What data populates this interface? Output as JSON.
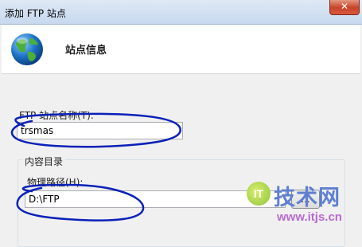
{
  "window": {
    "title": "添加 FTP 站点",
    "close_glyph": "✕"
  },
  "header": {
    "title": "站点信息",
    "icon": "globe-icon"
  },
  "site_name": {
    "label": "FTP 站点名称(T):",
    "value": "trsmas"
  },
  "content_dir": {
    "group_label": "内容目录",
    "path_label": "物理路径(H):",
    "path_value": "D:\\FTP",
    "browse_label": "..."
  },
  "watermark": {
    "logo": "IT",
    "main": "技术网",
    "url": "www.itjs.cn"
  },
  "colors": {
    "annotation": "#0b21b8",
    "title_bar": "#c7d8ee",
    "close_button": "#c7452a",
    "watermark_blue": "#5f7fd1",
    "watermark_purple": "#b86bd0"
  }
}
